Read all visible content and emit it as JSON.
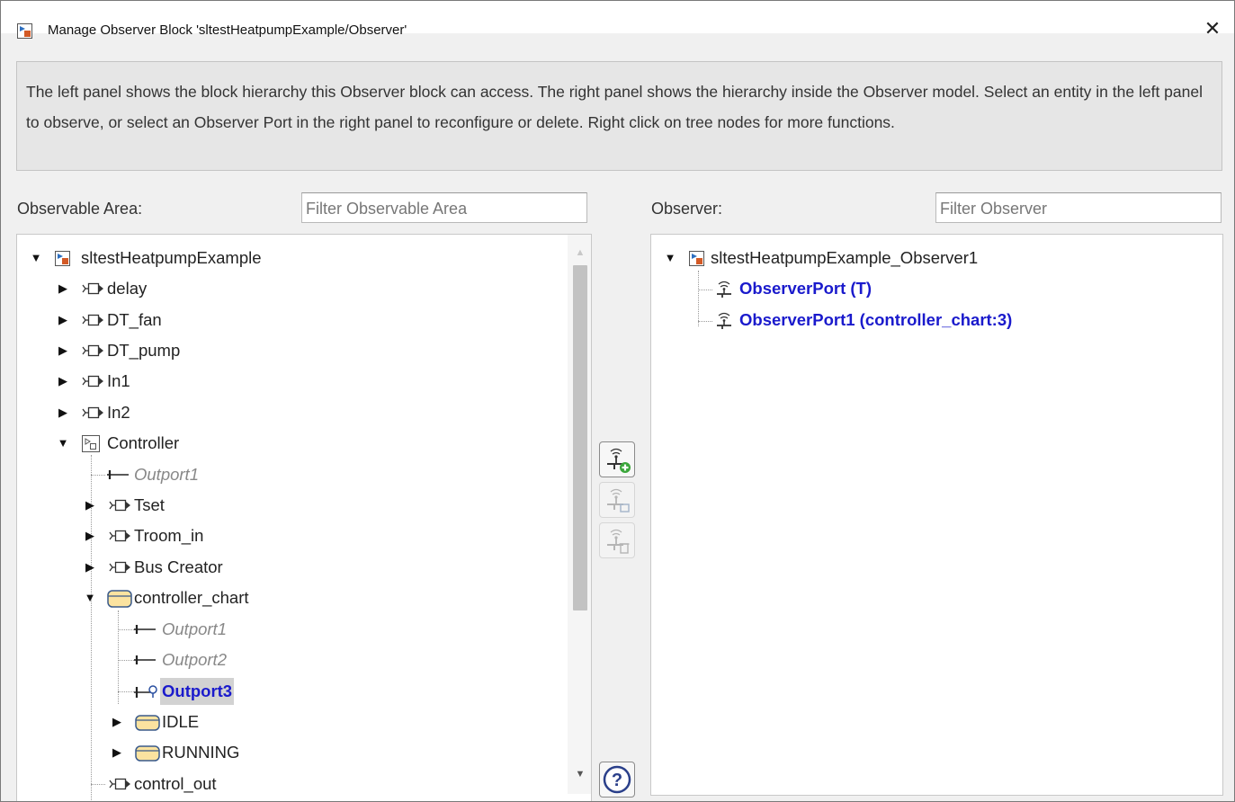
{
  "window": {
    "title": "Manage Observer Block 'sltestHeatpumpExample/Observer'",
    "app_icon": "simulink-model-icon",
    "close_icon": "close-icon",
    "close_symbol": "✕"
  },
  "info": {
    "text": "The left panel shows the block hierarchy this Observer block can access. The right panel shows the hierarchy inside the Observer model. Select an entity in the left panel to observe, or select an Observer Port in the right panel to reconfigure or delete. Right click on tree nodes for more functions."
  },
  "left": {
    "label": "Observable Area:",
    "filter_placeholder": "Filter Observable Area",
    "tree": [
      {
        "text": "sltestHeatpumpExample",
        "icon": "model-icon",
        "expander": "expanded"
      },
      {
        "text": "delay",
        "icon": "inport-block-icon",
        "expander": "collapsed"
      },
      {
        "text": "DT_fan",
        "icon": "inport-block-icon",
        "expander": "collapsed"
      },
      {
        "text": "DT_pump",
        "icon": "inport-block-icon",
        "expander": "collapsed"
      },
      {
        "text": "In1",
        "icon": "inport-block-icon",
        "expander": "collapsed"
      },
      {
        "text": "In2",
        "icon": "inport-block-icon",
        "expander": "collapsed"
      },
      {
        "text": "Controller",
        "icon": "subsystem-icon",
        "expander": "expanded"
      },
      {
        "text": "Outport1",
        "icon": "outport-icon",
        "expander": "none",
        "style": "italic"
      },
      {
        "text": "Tset",
        "icon": "inport-block-icon",
        "expander": "collapsed"
      },
      {
        "text": "Troom_in",
        "icon": "inport-block-icon",
        "expander": "collapsed"
      },
      {
        "text": "Bus Creator",
        "icon": "inport-block-icon",
        "expander": "collapsed"
      },
      {
        "text": "controller_chart",
        "icon": "stateflow-chart-icon",
        "expander": "expanded"
      },
      {
        "text": "Outport1",
        "icon": "outport-icon",
        "expander": "none",
        "style": "italic"
      },
      {
        "text": "Outport2",
        "icon": "outport-icon",
        "expander": "none",
        "style": "italic"
      },
      {
        "text": "Outport3",
        "icon": "observed-outport-icon",
        "expander": "none",
        "style": "selected"
      },
      {
        "text": "IDLE",
        "icon": "state-icon",
        "expander": "collapsed"
      },
      {
        "text": "RUNNING",
        "icon": "state-icon",
        "expander": "collapsed"
      },
      {
        "text": "control_out",
        "icon": "inport-block-icon",
        "expander": "none"
      }
    ],
    "scroll_up_icon": "scroll-up-icon",
    "scroll_down_icon": "scroll-down-icon"
  },
  "actions": {
    "add_icon": "add-observer-port-icon",
    "reconfigure_icon": "reconfigure-observer-port-icon",
    "delete_icon": "delete-observer-port-icon",
    "help_icon": "help-icon",
    "help_symbol": "?"
  },
  "right": {
    "label": "Observer:",
    "filter_placeholder": "Filter Observer",
    "tree": [
      {
        "text": "sltestHeatpumpExample_Observer1",
        "icon": "model-icon",
        "expander": "expanded"
      },
      {
        "text": "ObserverPort (T)",
        "icon": "observer-port-icon",
        "expander": "none",
        "style": "bold-blue"
      },
      {
        "text": "ObserverPort1 (controller_chart:3)",
        "icon": "observer-port-icon",
        "expander": "none",
        "style": "bold-blue"
      }
    ]
  },
  "colors": {
    "link_blue": "#1a1acc",
    "selection_gray": "#d2d2d2",
    "panel_background": "#ffffff",
    "dialog_background": "#f0f0f0",
    "add_green": "#3aa63a"
  }
}
